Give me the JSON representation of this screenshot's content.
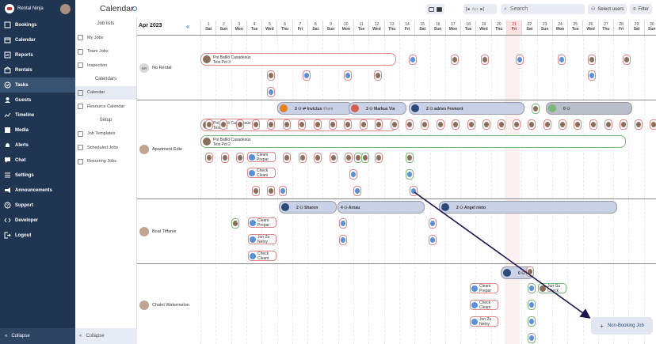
{
  "sidebar": {
    "brand": "Rental Ninja",
    "items": [
      {
        "label": "Bookings",
        "icon": "book-icon"
      },
      {
        "label": "Calendar",
        "icon": "calendar-icon"
      },
      {
        "label": "Reports",
        "icon": "reports-icon"
      },
      {
        "label": "Rentals",
        "icon": "rentals-icon"
      },
      {
        "label": "Tasks",
        "icon": "tasks-icon"
      },
      {
        "label": "Guests",
        "icon": "guests-icon"
      },
      {
        "label": "Timeline",
        "icon": "timeline-icon"
      },
      {
        "label": "Media",
        "icon": "media-icon"
      },
      {
        "label": "Alerts",
        "icon": "alert-icon"
      },
      {
        "label": "Chat",
        "icon": "chat-icon"
      },
      {
        "label": "Settings",
        "icon": "settings-icon"
      },
      {
        "label": "Announcements",
        "icon": "announce-icon"
      },
      {
        "label": "Support",
        "icon": "support-icon"
      },
      {
        "label": "Developer",
        "icon": "developer-icon"
      },
      {
        "label": "Logout",
        "icon": "logout-icon"
      }
    ],
    "collapse": "Collapse"
  },
  "panel": {
    "job_lists_title": "Job lists",
    "job_lists": [
      "My Jobs",
      "Team Jobs",
      "Inspection"
    ],
    "calendars_title": "Calendars",
    "calendars": [
      "Calendar",
      "Resource Calendar"
    ],
    "setup_title": "Setup",
    "setup": [
      "Job Templates",
      "Scheduled Jobs",
      "Recurring Jobs"
    ],
    "collapse": "Collapse"
  },
  "header": {
    "title": "Calendar",
    "month_label": "Apr",
    "search_placeholder": "Search",
    "select_users": "Select users",
    "filter": "Filter"
  },
  "calendar": {
    "month": "Apr 2023",
    "days": [
      [
        "1",
        "Sat"
      ],
      [
        "2",
        "Sun"
      ],
      [
        "3",
        "Mon"
      ],
      [
        "4",
        "Tue"
      ],
      [
        "5",
        "Wed"
      ],
      [
        "6",
        "Thu"
      ],
      [
        "7",
        "Fri"
      ],
      [
        "8",
        "Sat"
      ],
      [
        "9",
        "Sun"
      ],
      [
        "10",
        "Mon"
      ],
      [
        "11",
        "Tue"
      ],
      [
        "12",
        "Wed"
      ],
      [
        "13",
        "Thu"
      ],
      [
        "14",
        "Fri"
      ],
      [
        "15",
        "Sat"
      ],
      [
        "16",
        "Sun"
      ],
      [
        "17",
        "Mon"
      ],
      [
        "18",
        "Tue"
      ],
      [
        "19",
        "Wed"
      ],
      [
        "20",
        "Thu"
      ],
      [
        "21",
        "Fri"
      ],
      [
        "22",
        "Sat"
      ],
      [
        "23",
        "Sun"
      ],
      [
        "24",
        "Mon"
      ],
      [
        "25",
        "Tue"
      ],
      [
        "26",
        "Wed"
      ],
      [
        "27",
        "Thu"
      ],
      [
        "28",
        "Fri"
      ],
      [
        "29",
        "Sat"
      ],
      [
        "30",
        "Sun"
      ]
    ],
    "rentals": [
      {
        "name": "No Rental",
        "initials": "NR"
      },
      {
        "name": "Apartment Edie"
      },
      {
        "name": "Boat Tiffanie"
      },
      {
        "name": "Chalet Watermelon"
      }
    ],
    "bars": {
      "b1": "Pol Batlló Casadesús",
      "b1s": "Test Pol 3",
      "b2": "Pol Batlló Casadesús",
      "b2s": "Test Pol",
      "b3": "Pol Batlló Casadesús",
      "b3s": "Test Pol 2",
      "g1": "3",
      "g1b": "Invictus",
      "g1c": "#hom",
      "g2": "3",
      "g2b": "Markus Via",
      "g3": "2",
      "g3b": "adrien Fremont",
      "g4": "0",
      "g5": "2",
      "g5b": "Sharon",
      "g6": "4",
      "g6b": "Arnau",
      "g7": "2",
      "g7b": "Angel nieto",
      "g8": "0"
    },
    "minis": {
      "m1a": "Cleani",
      "m1b": "Prepar",
      "m2a": "Check",
      "m2b": "Cleani",
      "m3a": "Cleani",
      "m3b": "Prepar",
      "m4a": "Jon Zu",
      "m4b": "Netoy",
      "m5a": "Check",
      "m5b": "Cleani",
      "m6a": "Cleani",
      "m6b": "Prepar",
      "m7a": "Check",
      "m7b": "Cleani",
      "m8a": "Jon Zu",
      "m8b": "Netoy",
      "m9a": "Jon Gu",
      "m9b": "Check"
    }
  },
  "fab": {
    "label": "Non-Booking Job"
  }
}
